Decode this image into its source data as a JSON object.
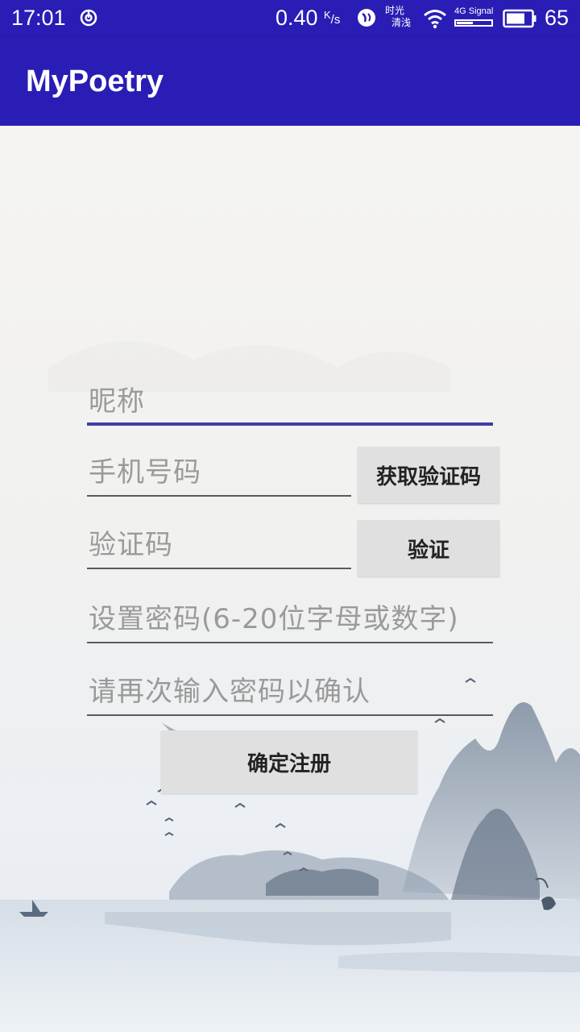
{
  "status_bar": {
    "time": "17:01",
    "speed": "0.40",
    "speed_unit_top": "K",
    "speed_unit_bottom": "/s",
    "label_line1": "时光",
    "label_line2": "清浅",
    "signal_text": "4G Signal",
    "battery": "65"
  },
  "app_bar": {
    "title": "MyPoetry"
  },
  "form": {
    "nickname_placeholder": "昵称",
    "phone_placeholder": "手机号码",
    "get_code_button": "获取验证码",
    "code_placeholder": "验证码",
    "verify_button": "验证",
    "password_placeholder": "设置密码(6-20位字母或数字)",
    "confirm_password_placeholder": "请再次输入密码以确认",
    "register_button": "确定注册"
  },
  "colors": {
    "primary": "#2a1db5",
    "field_active_underline": "#3f3fa6",
    "button_bg": "#e0e0e0"
  }
}
